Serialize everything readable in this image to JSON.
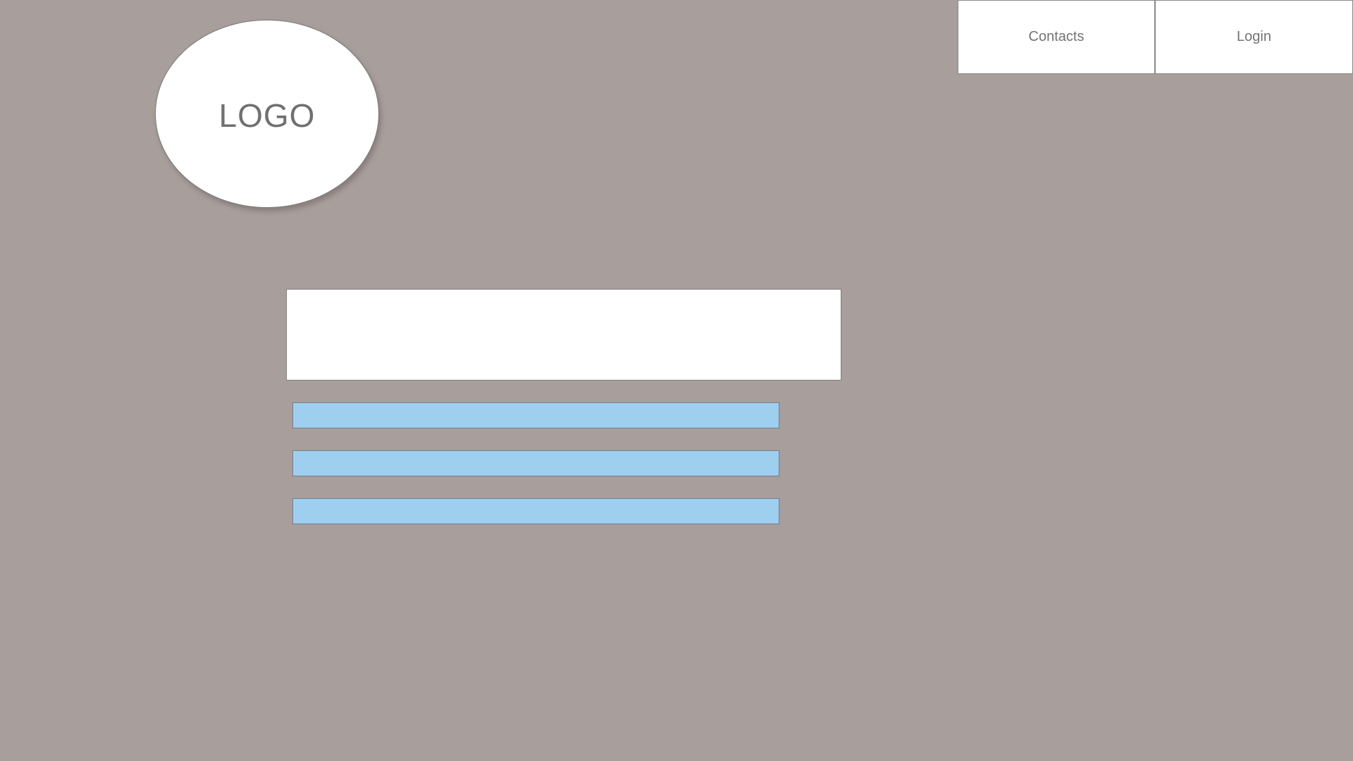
{
  "header": {
    "logo": {
      "text": "LOGO"
    },
    "nav": [
      {
        "label": "Contacts"
      },
      {
        "label": "Login"
      }
    ]
  },
  "main": {
    "panel": {
      "text": ""
    },
    "bars": [
      {
        "text": ""
      },
      {
        "text": ""
      },
      {
        "text": ""
      }
    ]
  },
  "colors": {
    "background": "#a89e9b",
    "panel": "#ffffff",
    "bar": "#9fcfee",
    "text": "#737373"
  }
}
